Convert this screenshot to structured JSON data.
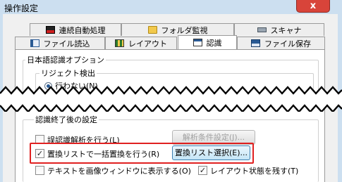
{
  "window": {
    "title": "操作設定",
    "close_glyph": "x"
  },
  "tabs_row1": [
    {
      "label": "連続自動処理",
      "icon": "continuous-process-icon"
    },
    {
      "label": "フォルダ監視",
      "icon": "folder-watch-icon"
    },
    {
      "label": "スキャナ",
      "icon": "scanner-icon"
    }
  ],
  "tabs_row2": [
    {
      "label": "ファイル読込",
      "icon": "file-load-icon"
    },
    {
      "label": "レイアウト",
      "icon": "layout-icon"
    },
    {
      "label": "認識",
      "icon": "recognition-icon",
      "active": true
    },
    {
      "label": "ファイル保存",
      "icon": "file-save-icon"
    }
  ],
  "japanese_options": {
    "label": "日本語認識オプション",
    "reject": {
      "label": "リジェクト検出",
      "radio_label": "行わない(N)",
      "radio_selected": true
    }
  },
  "post_settings": {
    "label": "認識終了後の設定",
    "misrecognition_check": {
      "label": "誤認識解析を行う(L)",
      "checked": false
    },
    "analysis_button": {
      "label": "解析条件設定(J)...",
      "enabled": false
    },
    "replace_check": {
      "label": "置換リストで一括置換を行う(R)",
      "checked": true
    },
    "replace_button": {
      "label": "置換リスト選択(E)...",
      "focused": true
    },
    "text_window_check": {
      "label": "テキストを画像ウィンドウに表示する(O)",
      "checked": false
    },
    "keep_layout_check": {
      "label": "レイアウト状態を残す(T)",
      "checked": true
    }
  },
  "highlight_color": "#e02020",
  "accent_color": "#2a5a94"
}
